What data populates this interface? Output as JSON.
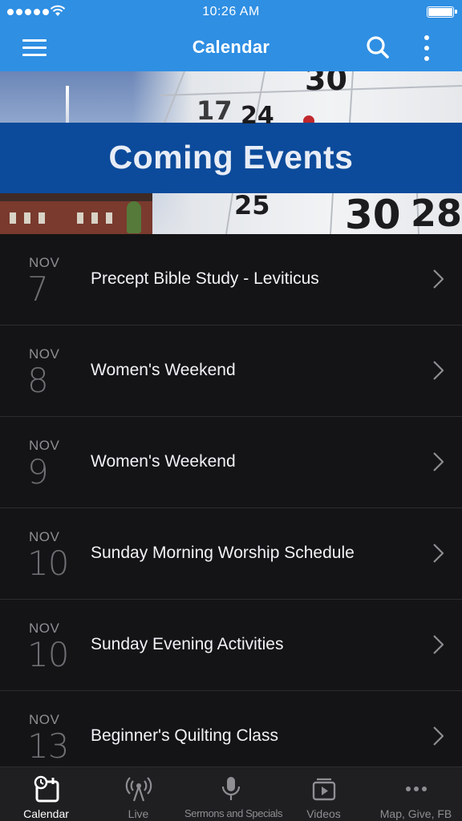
{
  "status_bar": {
    "time": "10:26 AM"
  },
  "navbar": {
    "title": "Calendar"
  },
  "banner": {
    "title": "Coming Events"
  },
  "events": [
    {
      "month": "NOV",
      "day": "7",
      "title": "Precept Bible Study - Leviticus"
    },
    {
      "month": "NOV",
      "day": "8",
      "title": "Women's Weekend"
    },
    {
      "month": "NOV",
      "day": "9",
      "title": "Women's Weekend"
    },
    {
      "month": "NOV",
      "day": "10",
      "title": "Sunday Morning Worship Schedule"
    },
    {
      "month": "NOV",
      "day": "10",
      "title": "Sunday Evening Activities"
    },
    {
      "month": "NOV",
      "day": "13",
      "title": "Beginner's Quilting Class"
    }
  ],
  "tabbar": {
    "tabs": [
      {
        "label": "Calendar",
        "icon": "calendar-clock-icon",
        "active": true
      },
      {
        "label": "Live",
        "icon": "broadcast-icon",
        "active": false
      },
      {
        "label": "Sermons and Specials",
        "icon": "microphone-icon",
        "active": false
      },
      {
        "label": "Videos",
        "icon": "video-icon",
        "active": false
      },
      {
        "label": "Map, Give, FB",
        "icon": "more-dots-icon",
        "active": false
      }
    ]
  },
  "colors": {
    "accent": "#2f8fe3",
    "banner_band": "#0c4b9b",
    "background": "#141416",
    "tabbar": "#1f1f21"
  }
}
